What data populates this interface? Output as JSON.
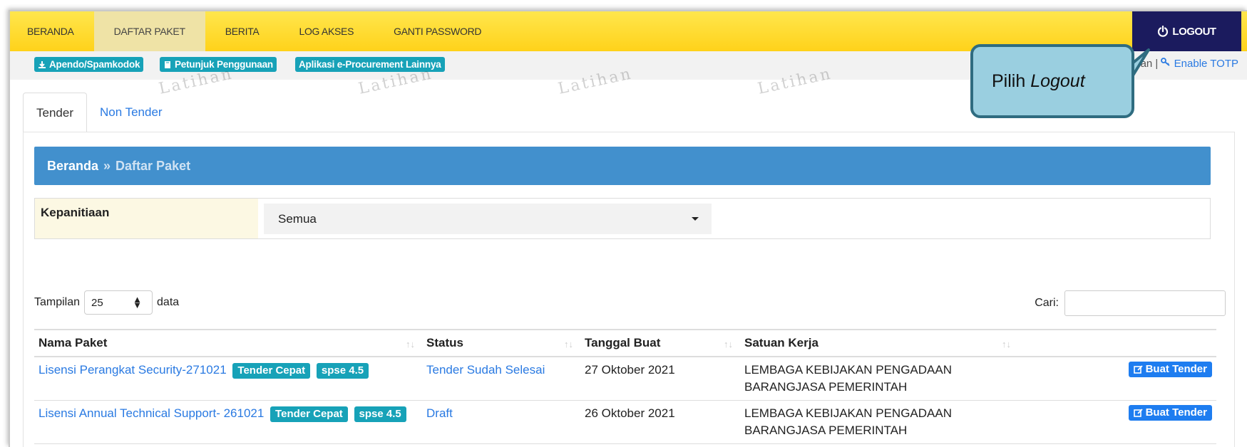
{
  "nav": {
    "items": [
      {
        "label": "BERANDA",
        "active": false
      },
      {
        "label": "DAFTAR PAKET",
        "active": true
      },
      {
        "label": "BERITA",
        "active": false
      },
      {
        "label": "LOG AKSES",
        "active": false
      },
      {
        "label": "GANTI PASSWORD",
        "active": false
      }
    ],
    "logout_label": "LOGOUT"
  },
  "toolbar": {
    "apendo_label": "Apendo/Spamkodok",
    "petunjuk_label": "Petunjuk Penggunaan",
    "aplikasi_label": "Aplikasi e-Procurement Lainnya"
  },
  "user_links": {
    "partial_text": "an |",
    "totp_label": "Enable TOTP"
  },
  "watermark_text": "Latihan",
  "tabs": [
    {
      "label": "Tender",
      "active": true
    },
    {
      "label": "Non Tender",
      "active": false
    }
  ],
  "breadcrumb": {
    "home": "Beranda",
    "separator": "»",
    "current": "Daftar Paket"
  },
  "filter": {
    "label": "Kepanitiaan",
    "selected": "Semua"
  },
  "table_controls": {
    "length_prefix": "Tampilan",
    "length_value": "25",
    "length_suffix": "data",
    "search_label": "Cari:"
  },
  "table": {
    "columns": [
      "Nama Paket",
      "Status",
      "Tanggal Buat",
      "Satuan Kerja"
    ],
    "rows": [
      {
        "nama_paket": "Lisensi Perangkat Security-271021",
        "badges": [
          "Tender Cepat",
          "spse 4.5"
        ],
        "status": "Tender Sudah Selesai",
        "tanggal_buat": "27 Oktober 2021",
        "satuan_kerja_line1": "LEMBAGA KEBIJAKAN PENGADAAN",
        "satuan_kerja_line2": "BARANGJASA PEMERINTAH",
        "action": "Buat Tender"
      },
      {
        "nama_paket": "Lisensi Annual Technical Support- 261021",
        "badges": [
          "Tender Cepat",
          "spse 4.5"
        ],
        "status": "Draft",
        "tanggal_buat": "26 Oktober 2021",
        "satuan_kerja_line1": "LEMBAGA KEBIJAKAN PENGADAAN",
        "satuan_kerja_line2": "BARANGJASA PEMERINTAH",
        "action": "Buat Tender"
      }
    ]
  },
  "callout": {
    "prefix": "Pilih ",
    "emphasis": "Logout"
  },
  "colors": {
    "nav_bg": "#ffd21a",
    "logout_bg": "#1b1b5e",
    "breadcrumb_bg": "#4290cd",
    "badge": "#17a2b8",
    "link": "#2a7ae2",
    "callout_bg": "#9acfe0"
  }
}
